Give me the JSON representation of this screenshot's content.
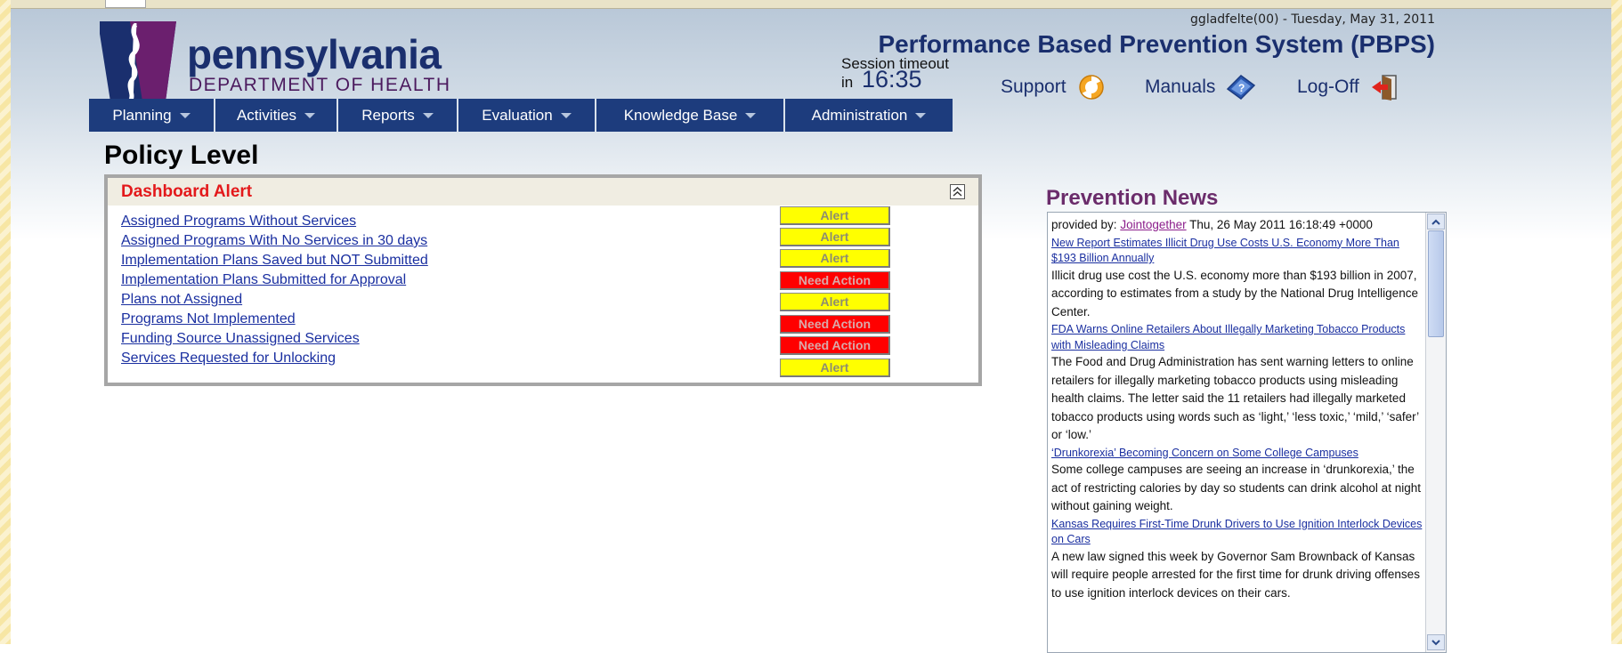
{
  "header": {
    "logo_title": "pennsylvania",
    "logo_subtitle": "DEPARTMENT OF HEALTH",
    "user_line": "ggladfelte(00) - Tuesday, May 31, 2011",
    "system_title": "Performance Based Prevention System (PBPS)",
    "session_timeout_label": "Session timeout",
    "session_timeout_in": "in",
    "session_timeout_value": "16:35",
    "support_label": "Support",
    "manuals_label": "Manuals",
    "logoff_label": "Log-Off"
  },
  "nav": {
    "items": [
      {
        "label": "Planning"
      },
      {
        "label": "Activities"
      },
      {
        "label": "Reports"
      },
      {
        "label": "Evaluation"
      },
      {
        "label": "Knowledge Base"
      },
      {
        "label": "Administration"
      }
    ]
  },
  "page_title": "Policy Level",
  "dashboard": {
    "title": "Dashboard Alert",
    "rows": [
      {
        "label": "Assigned Programs Without Services",
        "status": "Alert"
      },
      {
        "label": "Assigned Programs With No Services in 30 days",
        "status": "Alert"
      },
      {
        "label": "Implementation Plans Saved but NOT Submitted",
        "status": "Alert"
      },
      {
        "label": "Implementation Plans Submitted for Approval",
        "status": "Need Action"
      },
      {
        "label": "Plans not Assigned",
        "status": "Alert"
      },
      {
        "label": "Programs Not Implemented",
        "status": "Need Action"
      },
      {
        "label": "Funding Source Unassigned Services",
        "status": "Need Action"
      },
      {
        "label": "Services Requested for Unlocking",
        "status": "Alert"
      }
    ]
  },
  "news": {
    "title": "Prevention News",
    "provided_by": "provided by:",
    "source": "Jointogether",
    "date": "Thu, 26 May 2011 16:18:49 +0000",
    "items": [
      {
        "headline": "New Report Estimates Illicit Drug Use Costs U.S. Economy More Than $193 Billion Annually",
        "text": "Illicit drug use cost the U.S. economy more than $193 billion in 2007, according to estimates from a study by the National Drug Intelligence Center."
      },
      {
        "headline": "FDA Warns Online Retailers About Illegally Marketing Tobacco Products with Misleading Claims",
        "text": "The Food and Drug Administration has sent warning letters to online retailers for illegally marketing tobacco products using misleading health claims. The letter said the 11 retailers had illegally marketed tobacco products using words such as ‘light,’ ‘less toxic,’ ‘mild,’ ‘safer’ or ‘low.’"
      },
      {
        "headline": "‘Drunkorexia’ Becoming Concern on Some College Campuses",
        "text": "Some college campuses are seeing an increase in ‘drunkorexia,’ the act of restricting calories by day so students can drink alcohol at night without gaining weight."
      },
      {
        "headline": "Kansas Requires First-Time Drunk Drivers to Use Ignition Interlock Devices on Cars",
        "text": "A new law signed this week by Governor Sam Brownback of Kansas will require people arrested for the first time for drunk driving offenses to use ignition interlock devices on their cars."
      }
    ]
  },
  "colors": {
    "nav_bg": "#1d3c7d",
    "title_blue": "#1a2f6e",
    "alert_yellow": "#ffff00",
    "action_red": "#ff0000",
    "news_title": "#6b2c6b",
    "dash_title": "#e3191b"
  },
  "icons": [
    "keystone-logo-icon",
    "lifebuoy-icon",
    "manual-book-icon",
    "logoff-door-icon",
    "collapse-up-icon",
    "scroll-up-icon",
    "scroll-down-icon"
  ]
}
